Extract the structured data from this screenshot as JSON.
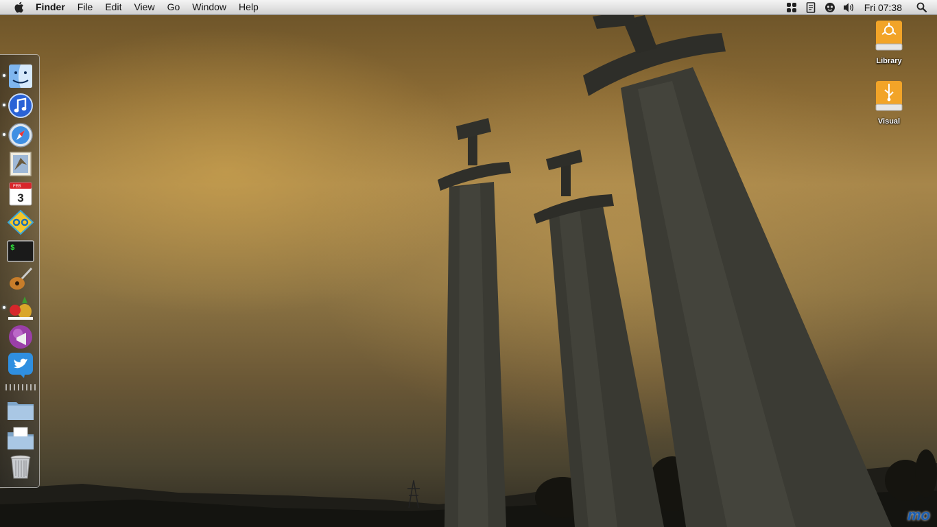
{
  "menubar": {
    "apple_icon": "apple-logo-icon",
    "items": [
      "Finder",
      "File",
      "Edit",
      "View",
      "Go",
      "Window",
      "Help"
    ],
    "status_icons": [
      "dashboard-icon",
      "script-icon",
      "growl-icon",
      "volume-icon"
    ],
    "clock": "Fri 07:38",
    "spotlight_icon": "spotlight-search-icon"
  },
  "dock": {
    "items": [
      {
        "name": "finder",
        "icon": "finder-icon",
        "running": true
      },
      {
        "name": "itunes",
        "icon": "itunes-icon",
        "running": true
      },
      {
        "name": "safari",
        "icon": "safari-icon",
        "running": true
      },
      {
        "name": "mail",
        "icon": "mail-icon",
        "running": false
      },
      {
        "name": "ical",
        "icon": "ical-icon",
        "running": false,
        "date_label": "3",
        "month_label": "FEB"
      },
      {
        "name": "app-yellow-diamond",
        "icon": "yellow-diamond-app-icon",
        "running": false
      },
      {
        "name": "terminal",
        "icon": "terminal-icon",
        "running": false,
        "prompt": "$"
      },
      {
        "name": "garageband",
        "icon": "garageband-icon",
        "running": false
      },
      {
        "name": "fruit-app",
        "icon": "fruit-app-icon",
        "running": true
      },
      {
        "name": "growl",
        "icon": "growl-megaphone-icon",
        "running": false
      },
      {
        "name": "twitter",
        "icon": "twitter-bird-icon",
        "running": false
      },
      {
        "name": "folder-applications",
        "icon": "folder-icon",
        "running": false
      },
      {
        "name": "folder-documents",
        "icon": "documents-folder-icon",
        "running": false
      },
      {
        "name": "trash",
        "icon": "trash-icon",
        "running": false
      }
    ]
  },
  "desktop": {
    "drives": [
      {
        "label": "Library",
        "icon": "firewire-drive-icon"
      },
      {
        "label": "Visual",
        "icon": "usb-drive-icon"
      }
    ],
    "watermark": "mo"
  },
  "colors": {
    "menubar_top": "#f4f4f4",
    "menubar_bottom": "#cfcfcf",
    "drive_orange": "#f2a428",
    "sky_gold": "#a7864a"
  }
}
